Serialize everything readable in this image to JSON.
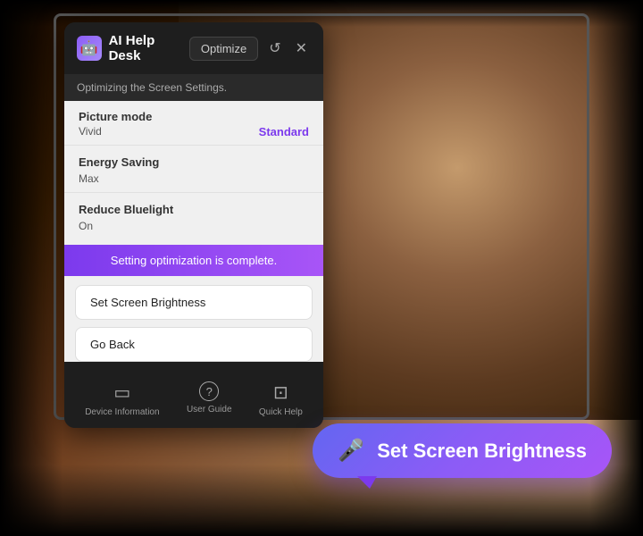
{
  "background": {
    "colors": [
      "#1a0a00",
      "#8b6040"
    ]
  },
  "panel": {
    "title": "AI Help Desk",
    "optimize_button": "Optimize",
    "status_text": "Optimizing the Screen Settings.",
    "complete_text": "Setting optimization is complete.",
    "settings": [
      {
        "label": "Picture mode",
        "value": "Vivid",
        "value_alt": "Standard",
        "has_highlight": true
      },
      {
        "label": "Energy Saving",
        "value": "Max",
        "has_highlight": false
      },
      {
        "label": "Reduce Bluelight",
        "value": "On",
        "has_highlight": false
      }
    ],
    "buttons": [
      {
        "label": "Set Screen Brightness"
      },
      {
        "label": "Go Back"
      }
    ],
    "footer": [
      {
        "label": "Device Information",
        "icon": "▭"
      },
      {
        "label": "User Guide",
        "icon": "?"
      },
      {
        "label": "Quick Help",
        "icon": "⊡"
      }
    ]
  },
  "voice_bubble": {
    "text": "Set Screen Brightness",
    "mic_icon": "🎤"
  },
  "icons": {
    "reset": "↺",
    "close": "✕",
    "ai_face": "🤖"
  }
}
